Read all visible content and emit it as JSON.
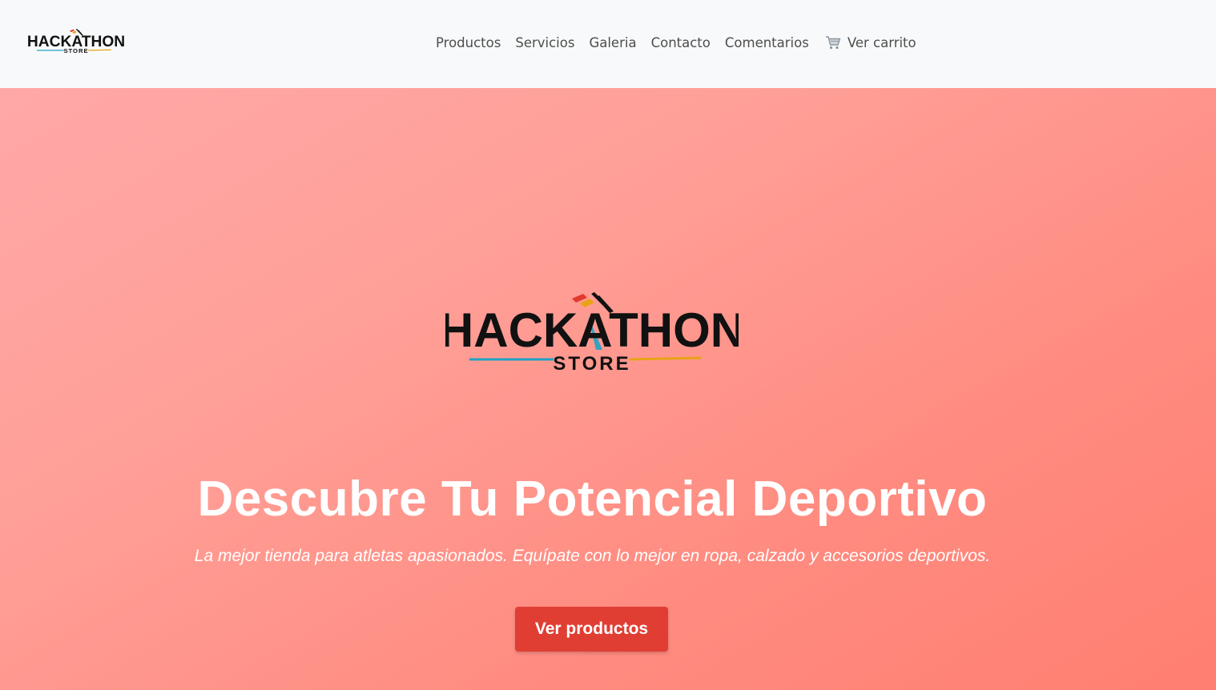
{
  "navbar": {
    "logo": {
      "wordmark": "HACKATHON",
      "sub": "STORE"
    },
    "links": [
      {
        "label": "Productos"
      },
      {
        "label": "Servicios"
      },
      {
        "label": "Galeria"
      },
      {
        "label": "Contacto"
      },
      {
        "label": "Comentarios"
      }
    ],
    "cart": {
      "label": "Ver carrito",
      "icon": "shopping-cart-icon"
    }
  },
  "hero": {
    "logo": {
      "wordmark": "HACKATHON",
      "sub": "STORE"
    },
    "title": "Descubre Tu Potencial Deportivo",
    "subtitle": "La mejor tienda para atletas apasionados. Equípate con lo mejor en ropa, calzado y accesorios deportivos.",
    "cta_label": "Ver productos"
  },
  "colors": {
    "navbar_bg": "#f8f9fa",
    "nav_text": "#4d4d4d",
    "hero_gradient_start": "#ffa8a8",
    "hero_gradient_end": "#ff7f71",
    "cta_bg": "#e03e33",
    "logo_blue": "#1fa3c4",
    "logo_orange": "#e8a316",
    "logo_red": "#e23a2e"
  }
}
